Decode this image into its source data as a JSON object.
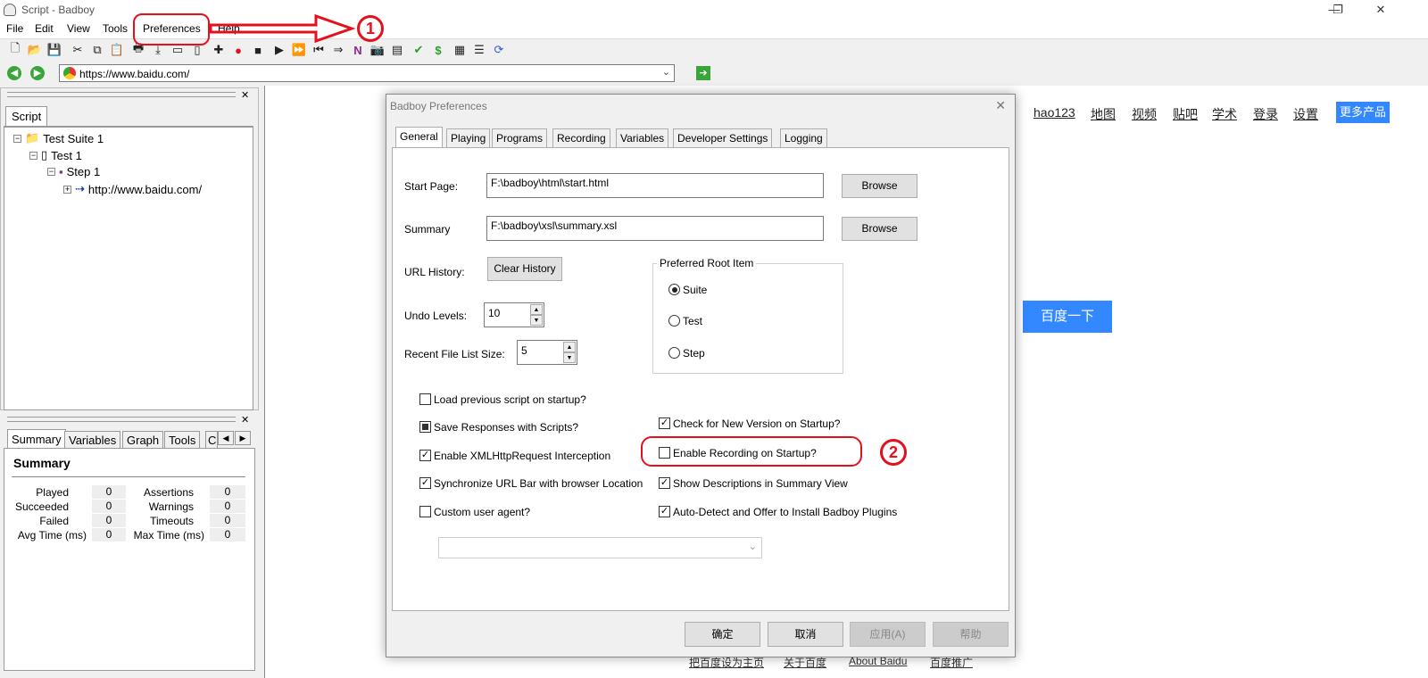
{
  "window": {
    "title": "Script - Badboy",
    "minimize": "—",
    "restore": "❐",
    "close": "✕"
  },
  "menu": {
    "file": "File",
    "edit": "Edit",
    "view": "View",
    "tools": "Tools",
    "preferences": "Preferences",
    "help": "Help"
  },
  "address": {
    "url": "https://www.baidu.com/"
  },
  "left_top": {
    "tab": "Script",
    "tree": {
      "suite": "Test Suite 1",
      "test": "Test 1",
      "step": "Step 1",
      "request": "http://www.baidu.com/"
    }
  },
  "left_bottom": {
    "tabs": [
      "Summary",
      "Variables",
      "Graph",
      "Tools",
      "C"
    ],
    "title": "Summary",
    "stats": {
      "played": {
        "label": "Played",
        "value": "0"
      },
      "succeeded": {
        "label": "Succeeded",
        "value": "0"
      },
      "failed": {
        "label": "Failed",
        "value": "0"
      },
      "avg_time": {
        "label": "Avg Time (ms)",
        "value": "0"
      },
      "assertions": {
        "label": "Assertions",
        "value": "0"
      },
      "warnings": {
        "label": "Warnings",
        "value": "0"
      },
      "timeouts": {
        "label": "Timeouts",
        "value": "0"
      },
      "max_time": {
        "label": "Max Time (ms)",
        "value": "0"
      }
    }
  },
  "browser": {
    "links": [
      "hao123",
      "地图",
      "视频",
      "贴吧",
      "学术",
      "登录",
      "设置"
    ],
    "more_products": "更多产品",
    "search_button": "百度一下",
    "footer": [
      "把百度设为主页",
      "关于百度",
      "About Baidu",
      "百度推广"
    ]
  },
  "dialog": {
    "title": "Badboy Preferences",
    "tabs": [
      "General",
      "Playing",
      "Programs",
      "Recording",
      "Variables",
      "Developer Settings",
      "Logging"
    ],
    "start_page_label": "Start Page:",
    "start_page_value": "F:\\badboy\\html\\start.html",
    "summary_label": "Summary",
    "summary_value": "F:\\badboy\\xsl\\summary.xsl",
    "browse": "Browse",
    "url_history_label": "URL History:",
    "clear_history": "Clear History",
    "undo_levels_label": "Undo Levels:",
    "undo_levels_value": "10",
    "recent_files_label": "Recent File List Size:",
    "recent_files_value": "5",
    "root_item_group": "Preferred Root Item",
    "root_options": {
      "suite": "Suite",
      "test": "Test",
      "step": "Step"
    },
    "checks": {
      "load_prev": "Load previous script on startup?",
      "save_responses": "Save Responses with Scripts?",
      "enable_xhr": "Enable XMLHttpRequest Interception",
      "sync_url": "Synchronize URL Bar with browser Location",
      "custom_agent": "Custom user agent?",
      "check_version": "Check for New Version on Startup?",
      "enable_recording": "Enable Recording on Startup?",
      "show_desc": "Show Descriptions in Summary View",
      "auto_detect": "Auto-Detect and Offer to Install Badboy Plugins"
    },
    "buttons": {
      "ok": "确定",
      "cancel": "取消",
      "apply": "应用(A)",
      "help": "帮助"
    }
  },
  "annotations": {
    "one": "1",
    "two": "2"
  },
  "colors": {
    "annotation": "#e4101d",
    "baidu_blue": "#3388ff"
  }
}
